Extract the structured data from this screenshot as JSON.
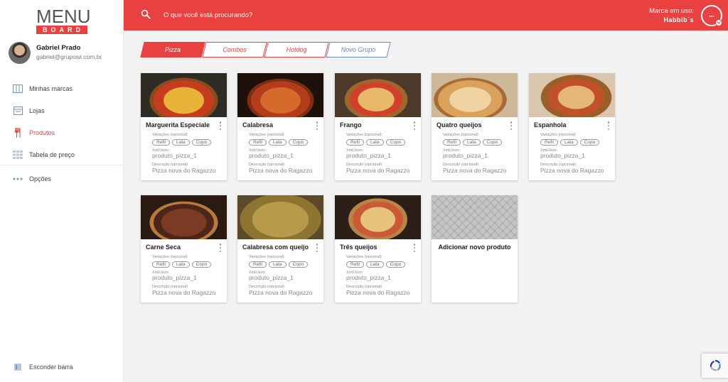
{
  "logo": {
    "top": "MENU",
    "bottom": "BOARD"
  },
  "user": {
    "name": "Gabriel Prado",
    "email": "gabriel@grupowi.com.br"
  },
  "sidebar": {
    "items": [
      {
        "label": "Minhas marcas",
        "icon": "brands-icon"
      },
      {
        "label": "Lojas",
        "icon": "store-icon"
      },
      {
        "label": "Produtos",
        "icon": "cutlery-icon",
        "active": true
      },
      {
        "label": "Tabela de preço",
        "icon": "grid-table-icon"
      },
      {
        "label": "Opções",
        "icon": "more-dots-icon"
      }
    ],
    "hide_label": "Esconder barra"
  },
  "header": {
    "search_placeholder": "O que você está procurando?",
    "brand_label": "Marca em uso:",
    "brand_name": "Habbib`s",
    "accent": "#e8413f"
  },
  "tabs": [
    {
      "label": "Pizza",
      "active": true
    },
    {
      "label": "Combos"
    },
    {
      "label": "Hotdog"
    },
    {
      "label": "Novo Grupo"
    }
  ],
  "card_labels": {
    "variations": "Variações (opcional)",
    "xml": "Xml/Json:",
    "description": "Descrição (opcional)"
  },
  "products": [
    {
      "name": "Marguerita Especiale",
      "chips": [
        "Refil",
        "Lata",
        "Copo"
      ],
      "xml": "produto_pizza_1",
      "description": "Pizza nova do Ragazzo"
    },
    {
      "name": "Calabresa",
      "chips": [
        "Refil",
        "Lata",
        "Copo"
      ],
      "xml": "produto_pizza_1",
      "description": "Pizza nova do Ragazzo"
    },
    {
      "name": "Frango",
      "chips": [
        "Refil",
        "Lata",
        "Copo"
      ],
      "xml": "produto_pizza_1",
      "description": "Pizza nova do Ragazzo"
    },
    {
      "name": "Quatro queijos",
      "chips": [
        "Refil",
        "Lata",
        "Copo"
      ],
      "xml": "produto_pizza_1",
      "description": "Pizza nova do Ragazzo"
    },
    {
      "name": "Espanhola",
      "chips": [
        "Refil",
        "Lata",
        "Copo"
      ],
      "xml": "produto_pizza_1",
      "description": "Pizza nova do Ragazzo"
    },
    {
      "name": "Carne Seca",
      "chips": [
        "Refil",
        "Lata",
        "Copo"
      ],
      "xml": "produto_pizza_1",
      "description": "Pizza nova do Ragazzo"
    },
    {
      "name": "Calabresa com queijo",
      "chips": [
        "Refil",
        "Lata",
        "Copo"
      ],
      "xml": "produto_pizza_1",
      "description": "Pizza nova do Ragazzo"
    },
    {
      "name": "Três queijos",
      "chips": [
        "Refil",
        "Lata",
        "Copo"
      ],
      "xml": "produto_pizza_1",
      "description": "Pizza nova do Ragazzo"
    }
  ],
  "add_product_label": "Adicionar novo produto"
}
